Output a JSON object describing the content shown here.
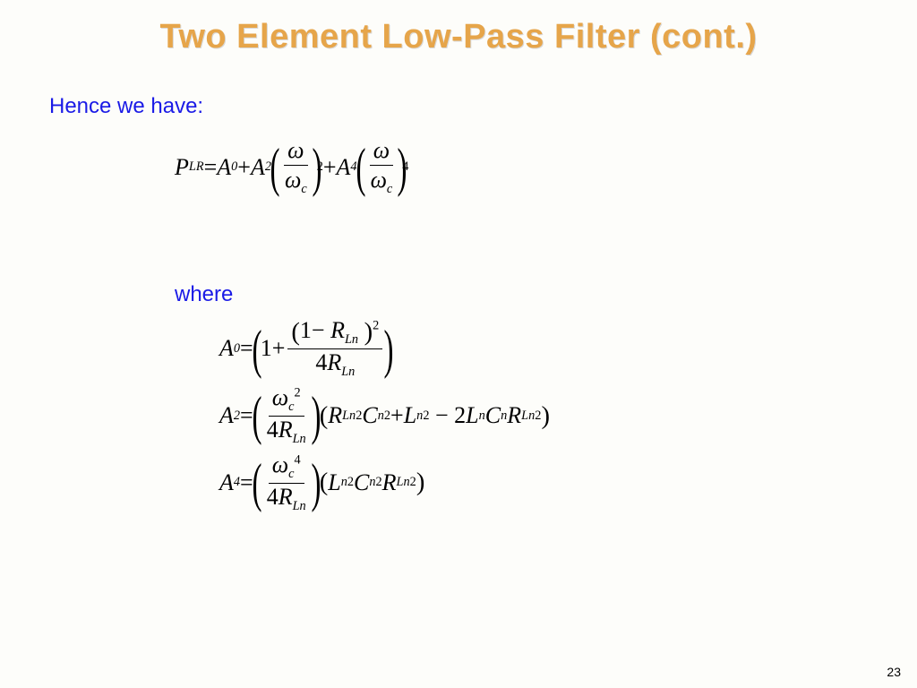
{
  "title": "Two Element Low-Pass Filter (cont.)",
  "intro": "Hence we have:",
  "where": "where",
  "pageNumber": "23",
  "sym": {
    "P": "P",
    "LR": "LR",
    "A": "A",
    "eq": " = ",
    "plus": " + ",
    "minus": "−",
    "omega": "ω",
    "c": "c",
    "zero": "0",
    "two": "2",
    "four": "4",
    "one": "1",
    "R": "R",
    "Ln": "Ln",
    "L": "L",
    "C": "C",
    "n": "n",
    "fourR": "4",
    "twoCoef": "2"
  }
}
